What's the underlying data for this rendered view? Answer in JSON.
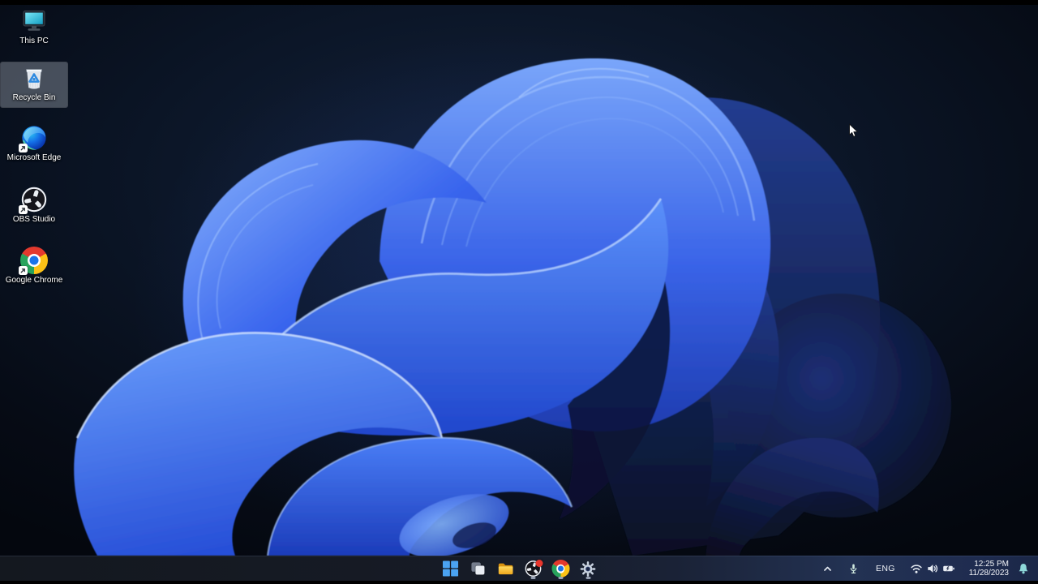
{
  "desktop": {
    "icons": [
      {
        "label": "This PC",
        "selected": false,
        "shortcut": false
      },
      {
        "label": "Recycle Bin",
        "selected": true,
        "shortcut": false
      },
      {
        "label": "Microsoft Edge",
        "selected": false,
        "shortcut": true
      },
      {
        "label": "OBS Studio",
        "selected": false,
        "shortcut": true
      },
      {
        "label": "Google Chrome",
        "selected": false,
        "shortcut": true
      }
    ]
  },
  "taskbar": {
    "buttons": [
      {
        "name": "Start"
      },
      {
        "name": "Task View"
      },
      {
        "name": "File Explorer"
      },
      {
        "name": "OBS Studio",
        "running": true,
        "badge": "recording"
      },
      {
        "name": "Google Chrome",
        "running": true
      },
      {
        "name": "Settings",
        "running": true
      }
    ],
    "tray": {
      "hidden_icons": "chevron-up",
      "microphone": "mic-in-use",
      "language": "ENG",
      "network": [
        "wifi",
        "volume",
        "battery-charging"
      ],
      "time": "12:25 PM",
      "date": "11/28/2023",
      "notification": "bell"
    }
  },
  "colors": {
    "accent_blue": "#3f6ef2",
    "bloom_highlight": "#9fc6ff",
    "bloom_deep": "#0a1330",
    "background_navy": "#0a1526",
    "taskbar_bg": "#161b26",
    "selection_gray": "rgba(140,148,158,0.48)",
    "recording_badge": "#e8352c",
    "bell_teal": "#8fd8da",
    "start_blue": "#4ba3f2"
  }
}
